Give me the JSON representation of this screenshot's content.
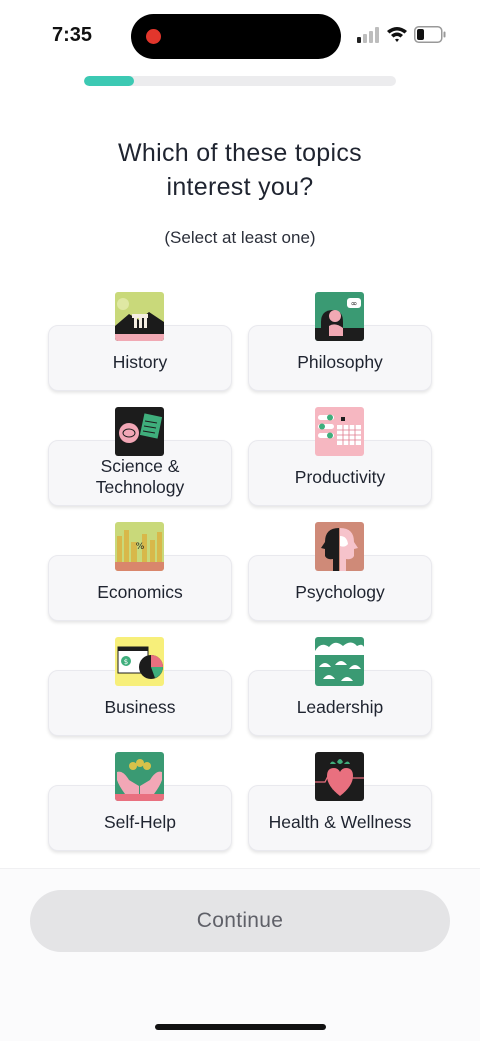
{
  "status": {
    "time": "7:35"
  },
  "progress": {
    "fraction": 0.16,
    "fill_color": "#3cc9b3"
  },
  "header": {
    "title_line1": "Which of these topics",
    "title_line2": "interest you?",
    "subtitle": "(Select at least one)"
  },
  "topics": [
    {
      "label": "History",
      "icon": "temple-icon"
    },
    {
      "label": "Philosophy",
      "icon": "thinker-icon"
    },
    {
      "label_line1": "Science &",
      "label_line2": "Technology",
      "icon": "chip-icon"
    },
    {
      "label": "Productivity",
      "icon": "planner-icon"
    },
    {
      "label": "Economics",
      "icon": "city-icon"
    },
    {
      "label": "Psychology",
      "icon": "profiles-icon"
    },
    {
      "label": "Business",
      "icon": "dashboard-icon"
    },
    {
      "label": "Leadership",
      "icon": "parachutes-icon"
    },
    {
      "label": "Self-Help",
      "icon": "hands-icon"
    },
    {
      "label": "Health & Wellness",
      "icon": "heart-icon"
    }
  ],
  "footer": {
    "continue_label": "Continue"
  },
  "colors": {
    "accent": "#3cc9b3",
    "button_bg": "#e4e4e6",
    "button_text": "#5f6068"
  }
}
